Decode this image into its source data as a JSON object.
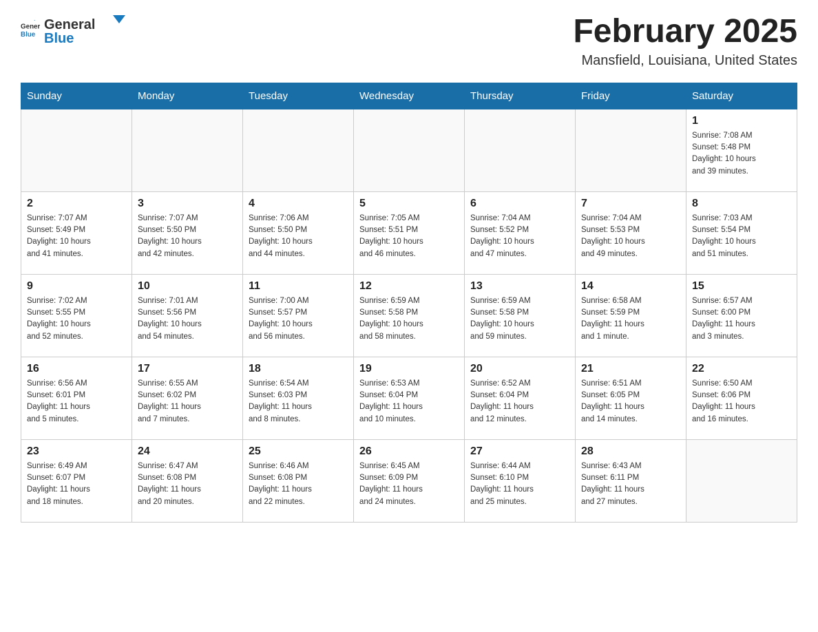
{
  "header": {
    "logo": {
      "general": "General",
      "blue": "Blue",
      "logo_alt": "GeneralBlue logo"
    },
    "title": "February 2025",
    "location": "Mansfield, Louisiana, United States"
  },
  "days_of_week": [
    "Sunday",
    "Monday",
    "Tuesday",
    "Wednesday",
    "Thursday",
    "Friday",
    "Saturday"
  ],
  "weeks": [
    {
      "days": [
        {
          "number": "",
          "info": ""
        },
        {
          "number": "",
          "info": ""
        },
        {
          "number": "",
          "info": ""
        },
        {
          "number": "",
          "info": ""
        },
        {
          "number": "",
          "info": ""
        },
        {
          "number": "",
          "info": ""
        },
        {
          "number": "1",
          "info": "Sunrise: 7:08 AM\nSunset: 5:48 PM\nDaylight: 10 hours\nand 39 minutes."
        }
      ]
    },
    {
      "days": [
        {
          "number": "2",
          "info": "Sunrise: 7:07 AM\nSunset: 5:49 PM\nDaylight: 10 hours\nand 41 minutes."
        },
        {
          "number": "3",
          "info": "Sunrise: 7:07 AM\nSunset: 5:50 PM\nDaylight: 10 hours\nand 42 minutes."
        },
        {
          "number": "4",
          "info": "Sunrise: 7:06 AM\nSunset: 5:50 PM\nDaylight: 10 hours\nand 44 minutes."
        },
        {
          "number": "5",
          "info": "Sunrise: 7:05 AM\nSunset: 5:51 PM\nDaylight: 10 hours\nand 46 minutes."
        },
        {
          "number": "6",
          "info": "Sunrise: 7:04 AM\nSunset: 5:52 PM\nDaylight: 10 hours\nand 47 minutes."
        },
        {
          "number": "7",
          "info": "Sunrise: 7:04 AM\nSunset: 5:53 PM\nDaylight: 10 hours\nand 49 minutes."
        },
        {
          "number": "8",
          "info": "Sunrise: 7:03 AM\nSunset: 5:54 PM\nDaylight: 10 hours\nand 51 minutes."
        }
      ]
    },
    {
      "days": [
        {
          "number": "9",
          "info": "Sunrise: 7:02 AM\nSunset: 5:55 PM\nDaylight: 10 hours\nand 52 minutes."
        },
        {
          "number": "10",
          "info": "Sunrise: 7:01 AM\nSunset: 5:56 PM\nDaylight: 10 hours\nand 54 minutes."
        },
        {
          "number": "11",
          "info": "Sunrise: 7:00 AM\nSunset: 5:57 PM\nDaylight: 10 hours\nand 56 minutes."
        },
        {
          "number": "12",
          "info": "Sunrise: 6:59 AM\nSunset: 5:58 PM\nDaylight: 10 hours\nand 58 minutes."
        },
        {
          "number": "13",
          "info": "Sunrise: 6:59 AM\nSunset: 5:58 PM\nDaylight: 10 hours\nand 59 minutes."
        },
        {
          "number": "14",
          "info": "Sunrise: 6:58 AM\nSunset: 5:59 PM\nDaylight: 11 hours\nand 1 minute."
        },
        {
          "number": "15",
          "info": "Sunrise: 6:57 AM\nSunset: 6:00 PM\nDaylight: 11 hours\nand 3 minutes."
        }
      ]
    },
    {
      "days": [
        {
          "number": "16",
          "info": "Sunrise: 6:56 AM\nSunset: 6:01 PM\nDaylight: 11 hours\nand 5 minutes."
        },
        {
          "number": "17",
          "info": "Sunrise: 6:55 AM\nSunset: 6:02 PM\nDaylight: 11 hours\nand 7 minutes."
        },
        {
          "number": "18",
          "info": "Sunrise: 6:54 AM\nSunset: 6:03 PM\nDaylight: 11 hours\nand 8 minutes."
        },
        {
          "number": "19",
          "info": "Sunrise: 6:53 AM\nSunset: 6:04 PM\nDaylight: 11 hours\nand 10 minutes."
        },
        {
          "number": "20",
          "info": "Sunrise: 6:52 AM\nSunset: 6:04 PM\nDaylight: 11 hours\nand 12 minutes."
        },
        {
          "number": "21",
          "info": "Sunrise: 6:51 AM\nSunset: 6:05 PM\nDaylight: 11 hours\nand 14 minutes."
        },
        {
          "number": "22",
          "info": "Sunrise: 6:50 AM\nSunset: 6:06 PM\nDaylight: 11 hours\nand 16 minutes."
        }
      ]
    },
    {
      "days": [
        {
          "number": "23",
          "info": "Sunrise: 6:49 AM\nSunset: 6:07 PM\nDaylight: 11 hours\nand 18 minutes."
        },
        {
          "number": "24",
          "info": "Sunrise: 6:47 AM\nSunset: 6:08 PM\nDaylight: 11 hours\nand 20 minutes."
        },
        {
          "number": "25",
          "info": "Sunrise: 6:46 AM\nSunset: 6:08 PM\nDaylight: 11 hours\nand 22 minutes."
        },
        {
          "number": "26",
          "info": "Sunrise: 6:45 AM\nSunset: 6:09 PM\nDaylight: 11 hours\nand 24 minutes."
        },
        {
          "number": "27",
          "info": "Sunrise: 6:44 AM\nSunset: 6:10 PM\nDaylight: 11 hours\nand 25 minutes."
        },
        {
          "number": "28",
          "info": "Sunrise: 6:43 AM\nSunset: 6:11 PM\nDaylight: 11 hours\nand 27 minutes."
        },
        {
          "number": "",
          "info": ""
        }
      ]
    }
  ]
}
